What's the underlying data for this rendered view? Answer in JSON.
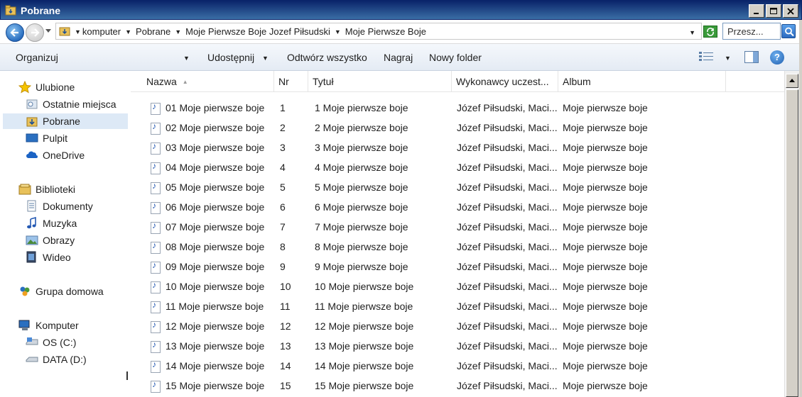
{
  "window": {
    "title": "Pobrane"
  },
  "address": {
    "crumbs": [
      "komputer",
      "Pobrane",
      "Moje Pierwsze Boje Jozef Piłsudski",
      "Moje Pierwsze Boje"
    ],
    "search_placeholder": "Przesz..."
  },
  "toolbar": {
    "organize": "Organizuj",
    "share": "Udostępnij",
    "play_all": "Odtwórz wszystko",
    "burn": "Nagraj",
    "new_folder": "Nowy folder"
  },
  "sidebar": {
    "favorites_header": "Ulubione",
    "favorites": [
      "Ostatnie miejsca",
      "Pobrane",
      "Pulpit",
      "OneDrive"
    ],
    "libraries_header": "Biblioteki",
    "libraries": [
      "Dokumenty",
      "Muzyka",
      "Obrazy",
      "Wideo"
    ],
    "homegroup": "Grupa domowa",
    "computer_header": "Komputer",
    "drives": [
      "OS (C:)",
      "DATA (D:)"
    ]
  },
  "columns": {
    "name": "Nazwa",
    "nr": "Nr",
    "title": "Tytuł",
    "artists": "Wykonawcy uczest...",
    "album": "Album"
  },
  "files": [
    {
      "name": "01 Moje pierwsze boje",
      "nr": "1",
      "title": "1 Moje pierwsze boje",
      "artists": "Józef Piłsudski, Maci...",
      "album": "Moje pierwsze boje"
    },
    {
      "name": "02 Moje pierwsze boje",
      "nr": "2",
      "title": "2 Moje pierwsze boje",
      "artists": "Józef Piłsudski, Maci...",
      "album": "Moje pierwsze boje"
    },
    {
      "name": "03 Moje pierwsze boje",
      "nr": "3",
      "title": "3 Moje pierwsze boje",
      "artists": "Józef Piłsudski, Maci...",
      "album": "Moje pierwsze boje"
    },
    {
      "name": "04 Moje pierwsze boje",
      "nr": "4",
      "title": "4 Moje pierwsze boje",
      "artists": "Józef Piłsudski, Maci...",
      "album": "Moje pierwsze boje"
    },
    {
      "name": "05 Moje pierwsze boje",
      "nr": "5",
      "title": "5 Moje pierwsze boje",
      "artists": "Józef Piłsudski, Maci...",
      "album": "Moje pierwsze boje"
    },
    {
      "name": "06 Moje pierwsze boje",
      "nr": "6",
      "title": "6 Moje pierwsze boje",
      "artists": "Józef Piłsudski, Maci...",
      "album": "Moje pierwsze boje"
    },
    {
      "name": "07 Moje pierwsze boje",
      "nr": "7",
      "title": "7 Moje pierwsze boje",
      "artists": "Józef Piłsudski, Maci...",
      "album": "Moje pierwsze boje"
    },
    {
      "name": "08 Moje pierwsze boje",
      "nr": "8",
      "title": "8 Moje pierwsze boje",
      "artists": "Józef Piłsudski, Maci...",
      "album": "Moje pierwsze boje"
    },
    {
      "name": "09 Moje pierwsze boje",
      "nr": "9",
      "title": "9 Moje pierwsze boje",
      "artists": "Józef Piłsudski, Maci...",
      "album": "Moje pierwsze boje"
    },
    {
      "name": "10 Moje pierwsze boje",
      "nr": "10",
      "title": "10 Moje pierwsze boje",
      "artists": "Józef Piłsudski, Maci...",
      "album": "Moje pierwsze boje"
    },
    {
      "name": "11 Moje pierwsze boje",
      "nr": "11",
      "title": "11 Moje pierwsze boje",
      "artists": "Józef Piłsudski, Maci...",
      "album": "Moje pierwsze boje"
    },
    {
      "name": "12 Moje pierwsze boje",
      "nr": "12",
      "title": "12 Moje pierwsze boje",
      "artists": "Józef Piłsudski, Maci...",
      "album": "Moje pierwsze boje"
    },
    {
      "name": "13 Moje pierwsze boje",
      "nr": "13",
      "title": "13 Moje pierwsze boje",
      "artists": "Józef Piłsudski, Maci...",
      "album": "Moje pierwsze boje"
    },
    {
      "name": "14 Moje pierwsze boje",
      "nr": "14",
      "title": "14 Moje pierwsze boje",
      "artists": "Józef Piłsudski, Maci...",
      "album": "Moje pierwsze boje"
    },
    {
      "name": "15 Moje pierwsze boje",
      "nr": "15",
      "title": "15 Moje pierwsze boje",
      "artists": "Józef Piłsudski, Maci...",
      "album": "Moje pierwsze boje"
    }
  ],
  "colors": {
    "titlebar_start": "#0a246a",
    "titlebar_end": "#3a6ea5",
    "selection": "#dde9f6"
  }
}
